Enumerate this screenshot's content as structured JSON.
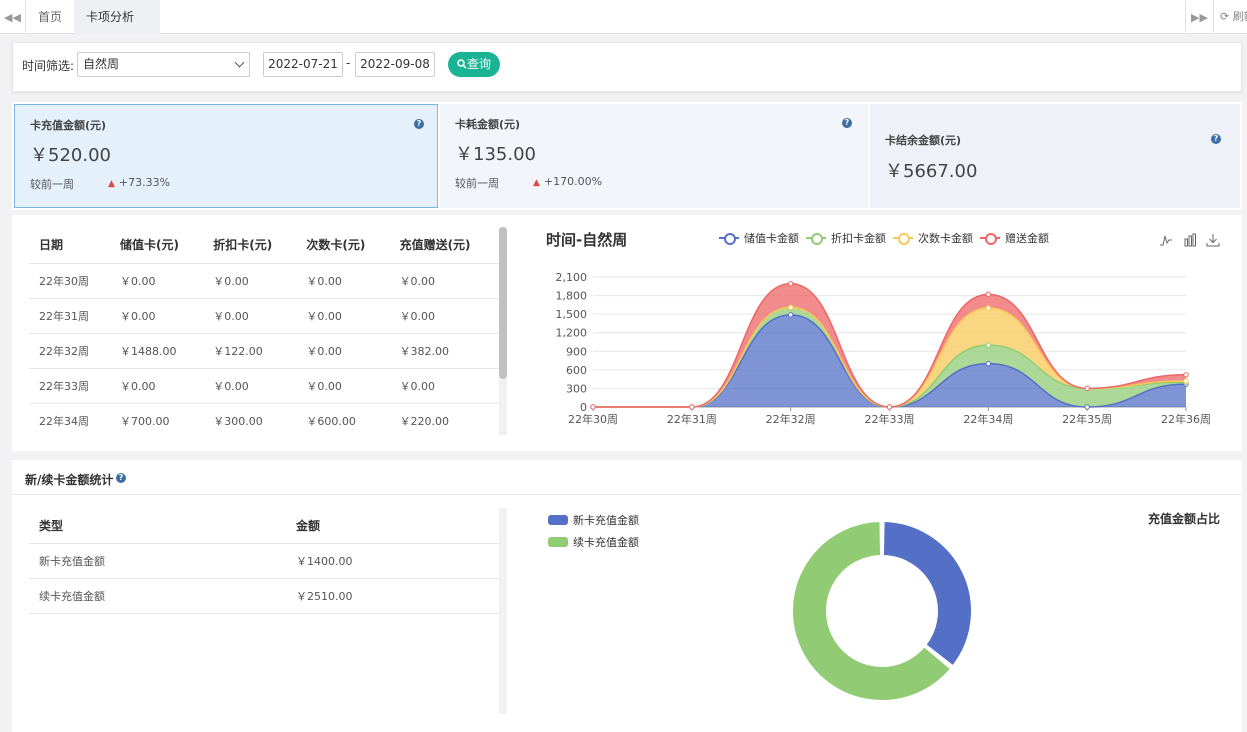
{
  "tabs": {
    "home": "首页",
    "active": "卡项分析",
    "refresh": "刷新"
  },
  "filter": {
    "label": "时间筛选:",
    "period": "自然周",
    "start_date": "2022-07-21",
    "separator": "-",
    "end_date": "2022-09-08",
    "query_button": "查询"
  },
  "stats": [
    {
      "title": "卡充值金额(元)",
      "value": "￥520.00",
      "compare_label": "较前一周",
      "change": "+73.33%"
    },
    {
      "title": "卡耗金额(元)",
      "value": "￥135.00",
      "compare_label": "较前一周",
      "change": "+170.00%"
    },
    {
      "title": "卡结余金额(元)",
      "value": "￥5667.00"
    }
  ],
  "weekly_table": {
    "headers": [
      "日期",
      "储值卡(元)",
      "折扣卡(元)",
      "次数卡(元)",
      "充值赠送(元)"
    ],
    "rows": [
      [
        "22年30周",
        "￥0.00",
        "￥0.00",
        "￥0.00",
        "￥0.00"
      ],
      [
        "22年31周",
        "￥0.00",
        "￥0.00",
        "￥0.00",
        "￥0.00"
      ],
      [
        "22年32周",
        "￥1488.00",
        "￥122.00",
        "￥0.00",
        "￥382.00"
      ],
      [
        "22年33周",
        "￥0.00",
        "￥0.00",
        "￥0.00",
        "￥0.00"
      ],
      [
        "22年34周",
        "￥700.00",
        "￥300.00",
        "￥600.00",
        "￥220.00"
      ]
    ]
  },
  "chart_data": [
    {
      "type": "area",
      "title": "时间-自然周",
      "categories": [
        "22年30周",
        "22年31周",
        "22年32周",
        "22年33周",
        "22年34周",
        "22年35周",
        "22年36周"
      ],
      "stacked": true,
      "smooth": true,
      "yticks": [
        0,
        300,
        600,
        900,
        1200,
        1500,
        1800,
        2100
      ],
      "ylim": [
        0,
        2100
      ],
      "grid": true,
      "legend_position": "top",
      "series": [
        {
          "name": "储值卡金额",
          "color": "#5470c6",
          "values": [
            0,
            0,
            1488,
            0,
            700,
            0,
            370
          ]
        },
        {
          "name": "折扣卡金额",
          "color": "#91cc75",
          "values": [
            0,
            0,
            122,
            0,
            300,
            300,
            30
          ]
        },
        {
          "name": "次数卡金额",
          "color": "#fac858",
          "values": [
            0,
            0,
            0,
            0,
            600,
            0,
            20
          ]
        },
        {
          "name": "赠送金额",
          "color": "#ee6666",
          "values": [
            0,
            0,
            382,
            0,
            220,
            0,
            100
          ]
        }
      ]
    },
    {
      "type": "pie",
      "title": "充值金额占比",
      "donut": true,
      "categories": [
        "新卡充值金额",
        "续卡充值金额"
      ],
      "values": [
        1400,
        2510
      ],
      "colors": [
        "#5470c6",
        "#91cc75"
      ],
      "legend_position": "top-left"
    }
  ],
  "ratio_section": {
    "title": "新/续卡金额统计",
    "headers": [
      "类型",
      "金额"
    ],
    "rows": [
      [
        "新卡充值金额",
        "￥1400.00"
      ],
      [
        "续卡充值金额",
        "￥2510.00"
      ]
    ]
  },
  "icons": {
    "prev_tabs": "double-chevron-left-icon",
    "next_tabs": "double-chevron-right-icon",
    "refresh": "refresh-icon",
    "help": "question-circle-icon",
    "search": "search-icon",
    "line_toggle": "line-chart-icon",
    "bar_toggle": "bar-chart-icon",
    "download": "download-icon"
  }
}
